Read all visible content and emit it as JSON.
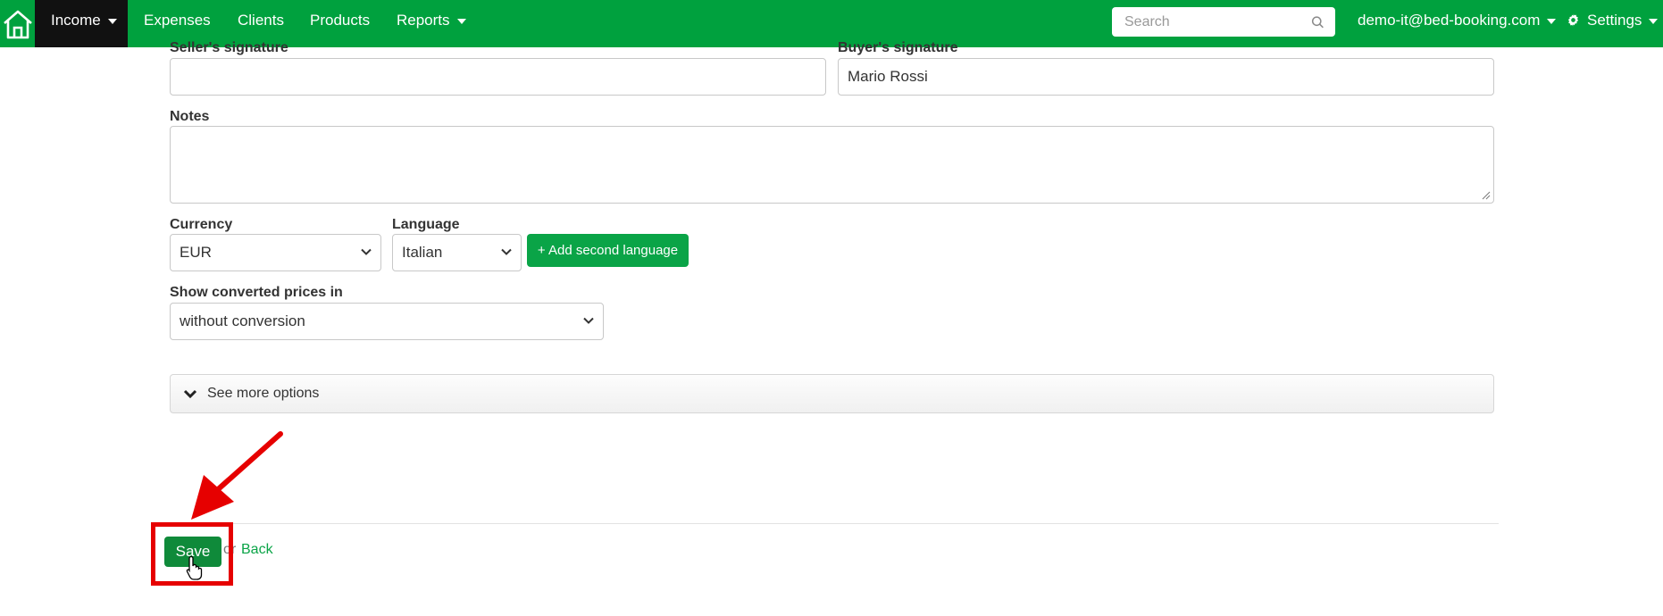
{
  "navbar": {
    "items": [
      {
        "label": "Income",
        "has_caret": true,
        "active": true
      },
      {
        "label": "Expenses"
      },
      {
        "label": "Clients"
      },
      {
        "label": "Products"
      },
      {
        "label": "Reports",
        "has_caret": true
      }
    ],
    "search": {
      "placeholder": "Search",
      "icon": "search-icon"
    },
    "user_label": "demo-it@bed-booking.com",
    "settings_label": "Settings"
  },
  "form": {
    "seller_signature": {
      "label": "Seller's signature",
      "value": ""
    },
    "buyer_signature": {
      "label": "Buyer's signature",
      "value": "Mario Rossi"
    },
    "notes": {
      "label": "Notes",
      "value": ""
    },
    "currency": {
      "label": "Currency",
      "value": "EUR"
    },
    "language": {
      "label": "Language",
      "value": "Italian"
    },
    "add_language_label": "+ Add second language",
    "converted_prices": {
      "label": "Show converted prices in",
      "value": "without conversion"
    },
    "more_options_label": "See more options"
  },
  "footer": {
    "save_label": "Save",
    "or_label": "or",
    "back_label": "Back"
  },
  "colors": {
    "brand_green": "#00a13e",
    "button_green": "#0aa447",
    "annotation_red": "#e60000"
  }
}
